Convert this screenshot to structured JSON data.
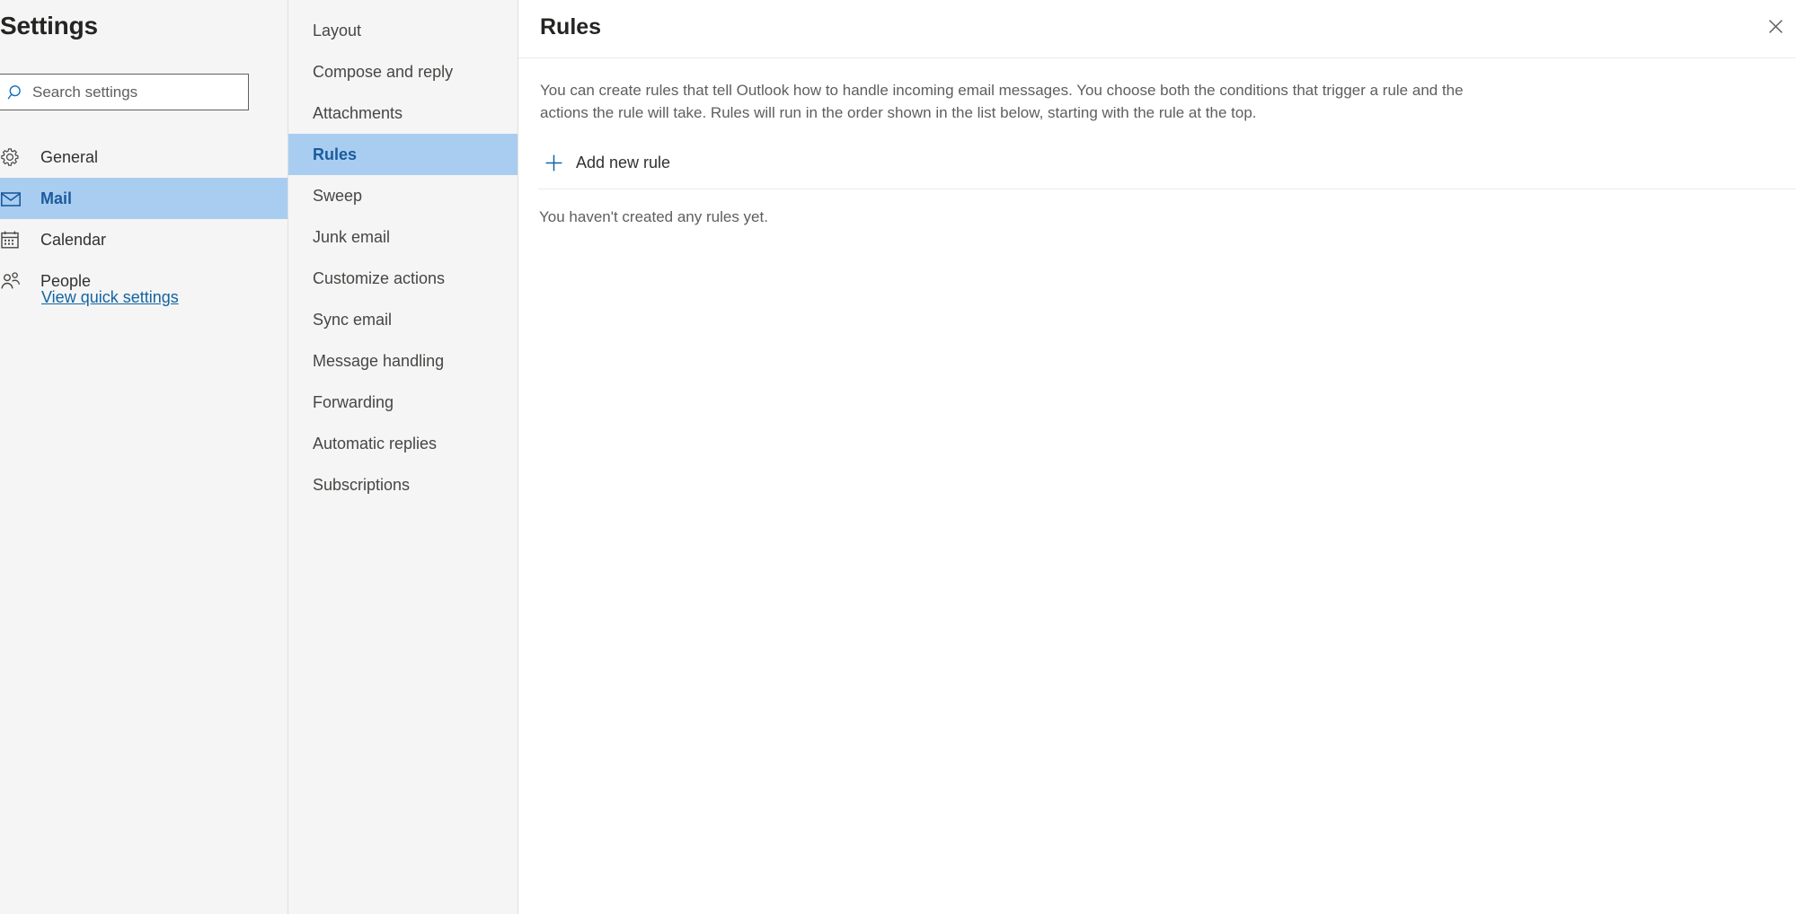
{
  "sidebar": {
    "title": "Settings",
    "search": {
      "placeholder": "Search settings",
      "value": "",
      "icon": "search-icon"
    },
    "items": [
      {
        "label": "General",
        "icon": "gear-icon",
        "selected": false
      },
      {
        "label": "Mail",
        "icon": "envelope-icon",
        "selected": true
      },
      {
        "label": "Calendar",
        "icon": "calendar-icon",
        "selected": false
      },
      {
        "label": "People",
        "icon": "people-icon",
        "selected": false
      }
    ],
    "quick_settings_label": "View quick settings"
  },
  "subnav": {
    "items": [
      {
        "label": "Layout",
        "selected": false
      },
      {
        "label": "Compose and reply",
        "selected": false
      },
      {
        "label": "Attachments",
        "selected": false
      },
      {
        "label": "Rules",
        "selected": true
      },
      {
        "label": "Sweep",
        "selected": false
      },
      {
        "label": "Junk email",
        "selected": false
      },
      {
        "label": "Customize actions",
        "selected": false
      },
      {
        "label": "Sync email",
        "selected": false
      },
      {
        "label": "Message handling",
        "selected": false
      },
      {
        "label": "Forwarding",
        "selected": false
      },
      {
        "label": "Automatic replies",
        "selected": false
      },
      {
        "label": "Subscriptions",
        "selected": false
      }
    ]
  },
  "content": {
    "title": "Rules",
    "close_icon": "close-icon",
    "description": "You can create rules that tell Outlook how to handle incoming email messages. You choose both the conditions that trigger a rule and the actions the rule will take. Rules will run in the order shown in the list below, starting with the rule at the top.",
    "add_rule_label": "Add new rule",
    "add_rule_icon": "plus-icon",
    "empty_state": "You haven't created any rules yet."
  },
  "colors": {
    "selection_background": "#a9cdf0",
    "selection_text": "#1b5a9e",
    "link": "#1264a3",
    "accent": "#0f6cbd",
    "panel_background": "#f5f5f5",
    "body_text": "#605e5c",
    "heading_text": "#252423"
  }
}
